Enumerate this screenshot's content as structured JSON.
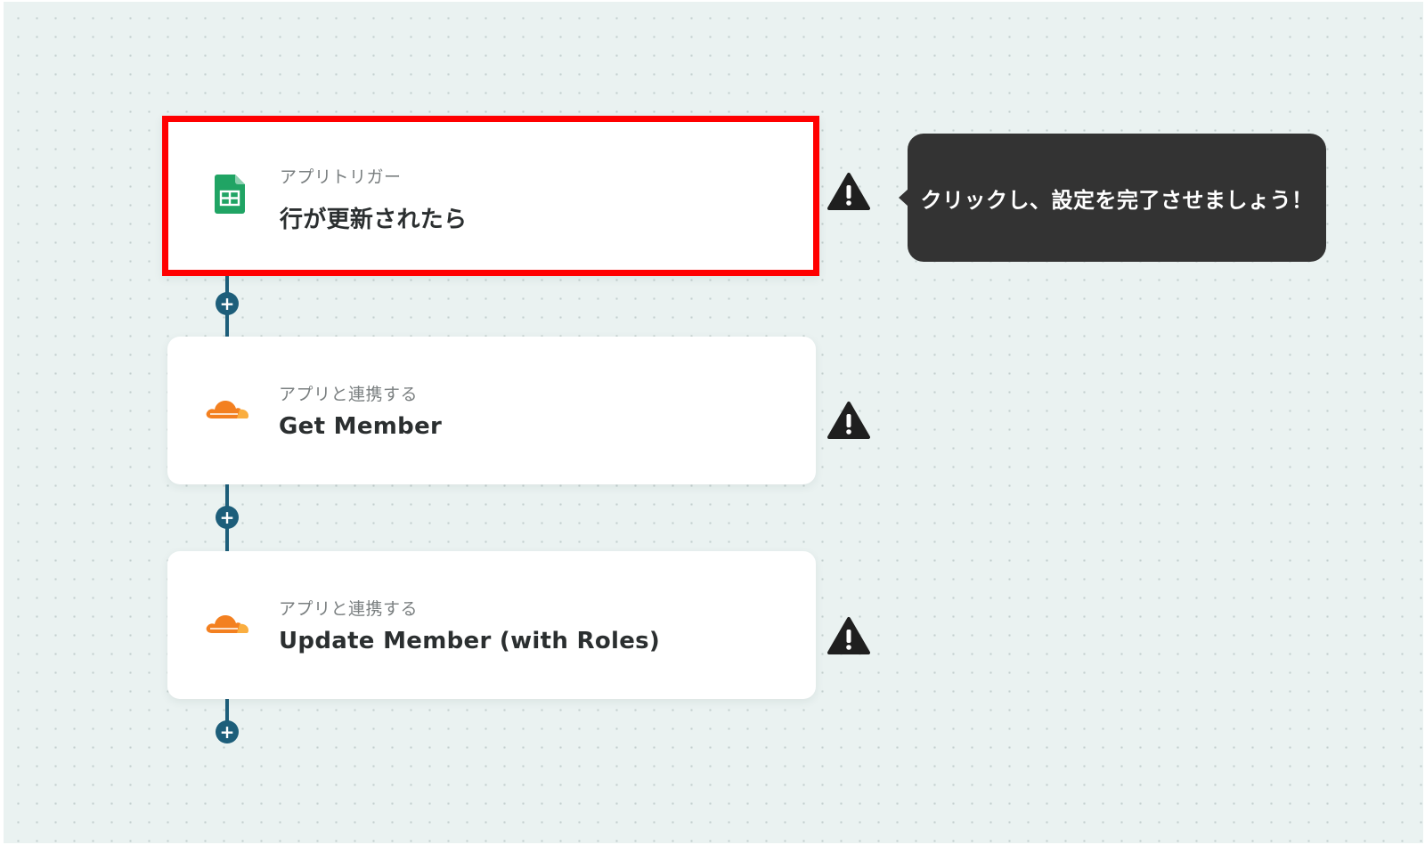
{
  "flow": {
    "steps": [
      {
        "app_icon": "google-sheets-icon",
        "subtitle": "アプリトリガー",
        "title": "行が更新されたら",
        "selected": true,
        "warning_icon": "warning-icon"
      },
      {
        "app_icon": "cloudflare-icon",
        "subtitle": "アプリと連携する",
        "title": "Get Member",
        "selected": false,
        "warning_icon": "warning-icon"
      },
      {
        "app_icon": "cloudflare-icon",
        "subtitle": "アプリと連携する",
        "title": "Update Member (with Roles)",
        "selected": false,
        "warning_icon": "warning-icon"
      }
    ],
    "add_step_icon": "plus-icon",
    "add_step_symbol": "+"
  },
  "tooltip": {
    "text": "クリックし、設定を完了させましょう！"
  },
  "colors": {
    "canvas_bg": "#eaf2f1",
    "connector": "#1d5e7a",
    "highlight_border": "#ff0000",
    "tooltip_bg": "#333333",
    "sheets_green": "#20a464",
    "cloudflare_orange": "#f38020",
    "cloudflare_light": "#faae40",
    "warning": "#1f1f1f"
  }
}
